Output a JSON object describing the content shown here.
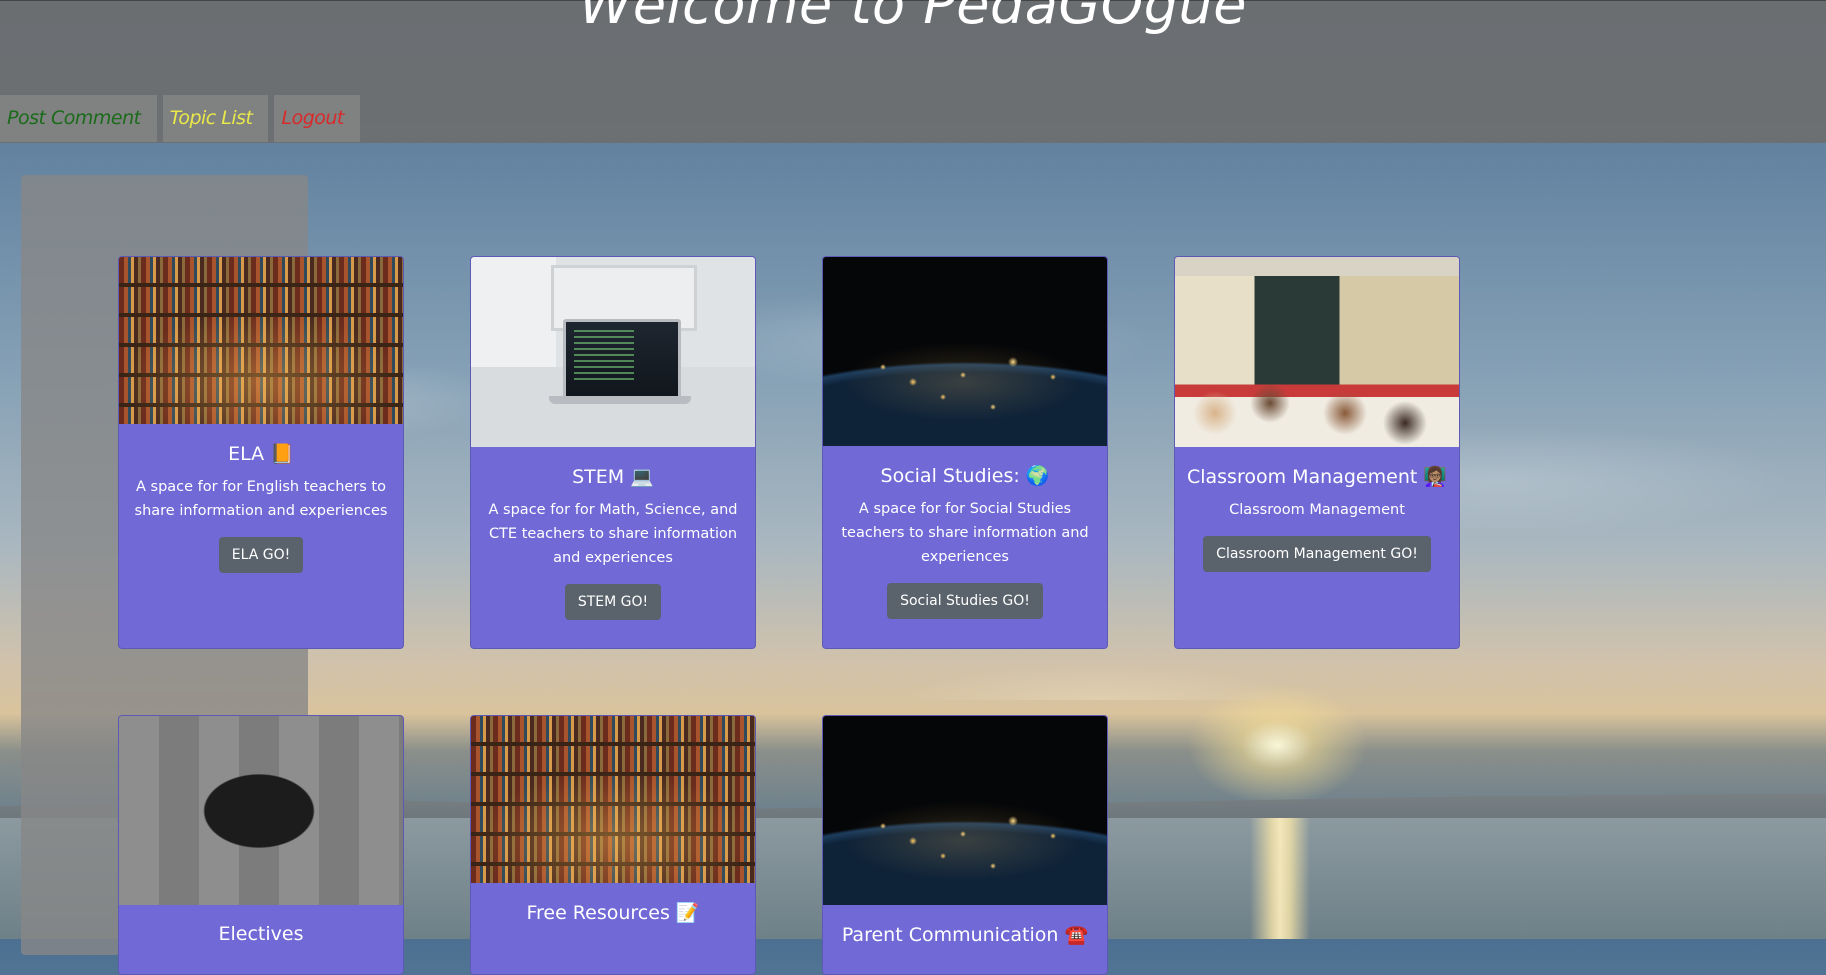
{
  "header": {
    "title": "Welcome to PedaGOgue"
  },
  "nav": [
    {
      "label": "Post Comment",
      "color": "#1a6b1a"
    },
    {
      "label": "Topic List",
      "color": "#e8e84a"
    },
    {
      "label": "Logout",
      "color": "#d82a2a"
    }
  ],
  "cards": [
    {
      "title": "ELA 📙",
      "text": "A space for for English teachers to share information and experiences",
      "button": "ELA GO!",
      "image": "bookshelf-photo"
    },
    {
      "title": "STEM 💻",
      "text": "A space for for Math, Science, and CTE teachers to share information and experiences",
      "button": "STEM GO!",
      "image": "laptop-desk-photo"
    },
    {
      "title": "Social Studies: 🌍",
      "text": "A space for for Social Studies teachers to share information and experiences",
      "button": "Social Studies GO!",
      "image": "earth-at-night-photo"
    },
    {
      "title": "Classroom Management 👩🏽‍🏫",
      "text": "Classroom Management",
      "button": "Classroom Management GO!",
      "image": "classroom-photo"
    },
    {
      "title": "Electives",
      "image": "sports-team-photo"
    },
    {
      "title": "Free Resources 📝",
      "image": "bookshelf-photo"
    },
    {
      "title": "Parent Communication ☎️",
      "image": "earth-at-night-photo"
    }
  ],
  "colors": {
    "card_bg": "#7069d6",
    "button_bg": "#5a636c",
    "header_bg": "#6e6e6e"
  }
}
